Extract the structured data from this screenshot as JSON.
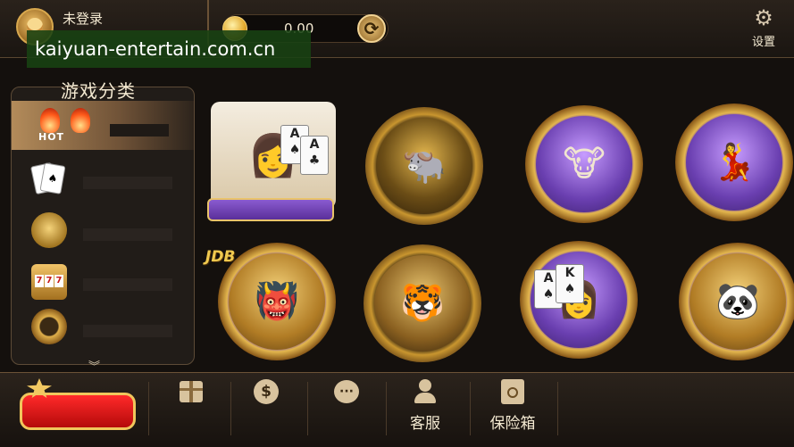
{
  "header": {
    "username": "未登录",
    "balance": "0.00",
    "settings_label": "设置"
  },
  "watermark": "kaiyuan-entertain.com.cn",
  "sidebar": {
    "title": "游戏分类",
    "items": [
      {
        "name": "hot",
        "badge": "HOT"
      },
      {
        "name": "cards"
      },
      {
        "name": "fishing"
      },
      {
        "name": "slots"
      },
      {
        "name": "other"
      }
    ]
  },
  "games": [
    {
      "name": "poker-dealer-girl",
      "style": "gold"
    },
    {
      "name": "bull-fight-gold",
      "style": "gold"
    },
    {
      "name": "bull-purple",
      "style": "purple"
    },
    {
      "name": "poker-queen-purple",
      "style": "purple"
    },
    {
      "name": "jdb-warrior",
      "style": "purple",
      "logo": "JDB"
    },
    {
      "name": "dragon-tiger",
      "style": "gold"
    },
    {
      "name": "poker-lady",
      "style": "purple"
    },
    {
      "name": "panda-dealer",
      "style": "gold"
    }
  ],
  "bottom": {
    "customer_service": "客服",
    "safe_box": "保险箱"
  },
  "colors": {
    "background": "#14100d",
    "gold": "#e4b74e",
    "purple": "#6a3fb0",
    "red_button": "#d81414",
    "watermark_bg": "#184212"
  }
}
